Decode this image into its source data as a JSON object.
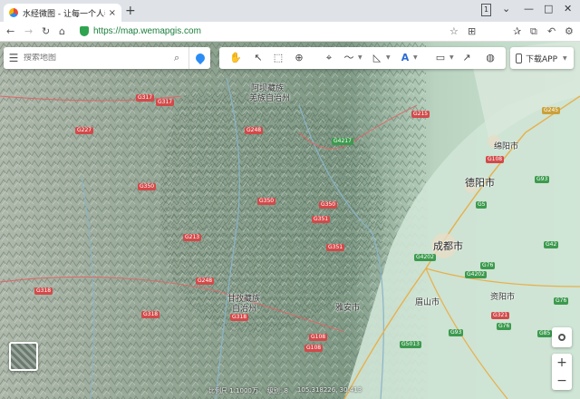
{
  "browser": {
    "tab_title": "水经微图 - 让每一个人都有自己的",
    "tab_close": "×",
    "new_tab": "+",
    "url": "https://map.wemapgis.com",
    "window_badge": "1"
  },
  "search": {
    "placeholder": "搜索地图"
  },
  "app_button": {
    "label": "下载APP"
  },
  "zoom": {
    "in": "+",
    "out": "−"
  },
  "map_labels": {
    "aba": "阿坝藏族",
    "aba2": "羌族自治州",
    "ganzi": "甘孜藏族",
    "ganzi2": "自治州",
    "chengdu": "成都市",
    "deyang": "德阳市",
    "mianyang": "绵阳市",
    "yaan": "雅安市",
    "meishan": "眉山市",
    "ziyang": "资阳市"
  },
  "roads": [
    {
      "text": "G317"
    },
    {
      "text": "G317"
    },
    {
      "text": "G227"
    },
    {
      "text": "G248"
    },
    {
      "text": "G350"
    },
    {
      "text": "G350"
    },
    {
      "text": "G4217"
    },
    {
      "text": "G215"
    },
    {
      "text": "G351"
    },
    {
      "text": "G350"
    },
    {
      "text": "G351"
    },
    {
      "text": "G248"
    },
    {
      "text": "G318"
    },
    {
      "text": "G318"
    },
    {
      "text": "G318"
    },
    {
      "text": "G108"
    },
    {
      "text": "G213"
    },
    {
      "text": "G5"
    },
    {
      "text": "G4202"
    },
    {
      "text": "G4202"
    },
    {
      "text": "G76"
    },
    {
      "text": "G108"
    },
    {
      "text": "G93"
    },
    {
      "text": "G42"
    },
    {
      "text": "G76"
    },
    {
      "text": "G93"
    },
    {
      "text": "G5013"
    },
    {
      "text": "G245"
    },
    {
      "text": "G321"
    },
    {
      "text": "G85"
    },
    {
      "text": "G76"
    },
    {
      "text": "G108"
    }
  ],
  "status": {
    "scale": "比例尺 1:1000万",
    "level": "级别: 8",
    "coords": "105.318226, 30.413"
  }
}
